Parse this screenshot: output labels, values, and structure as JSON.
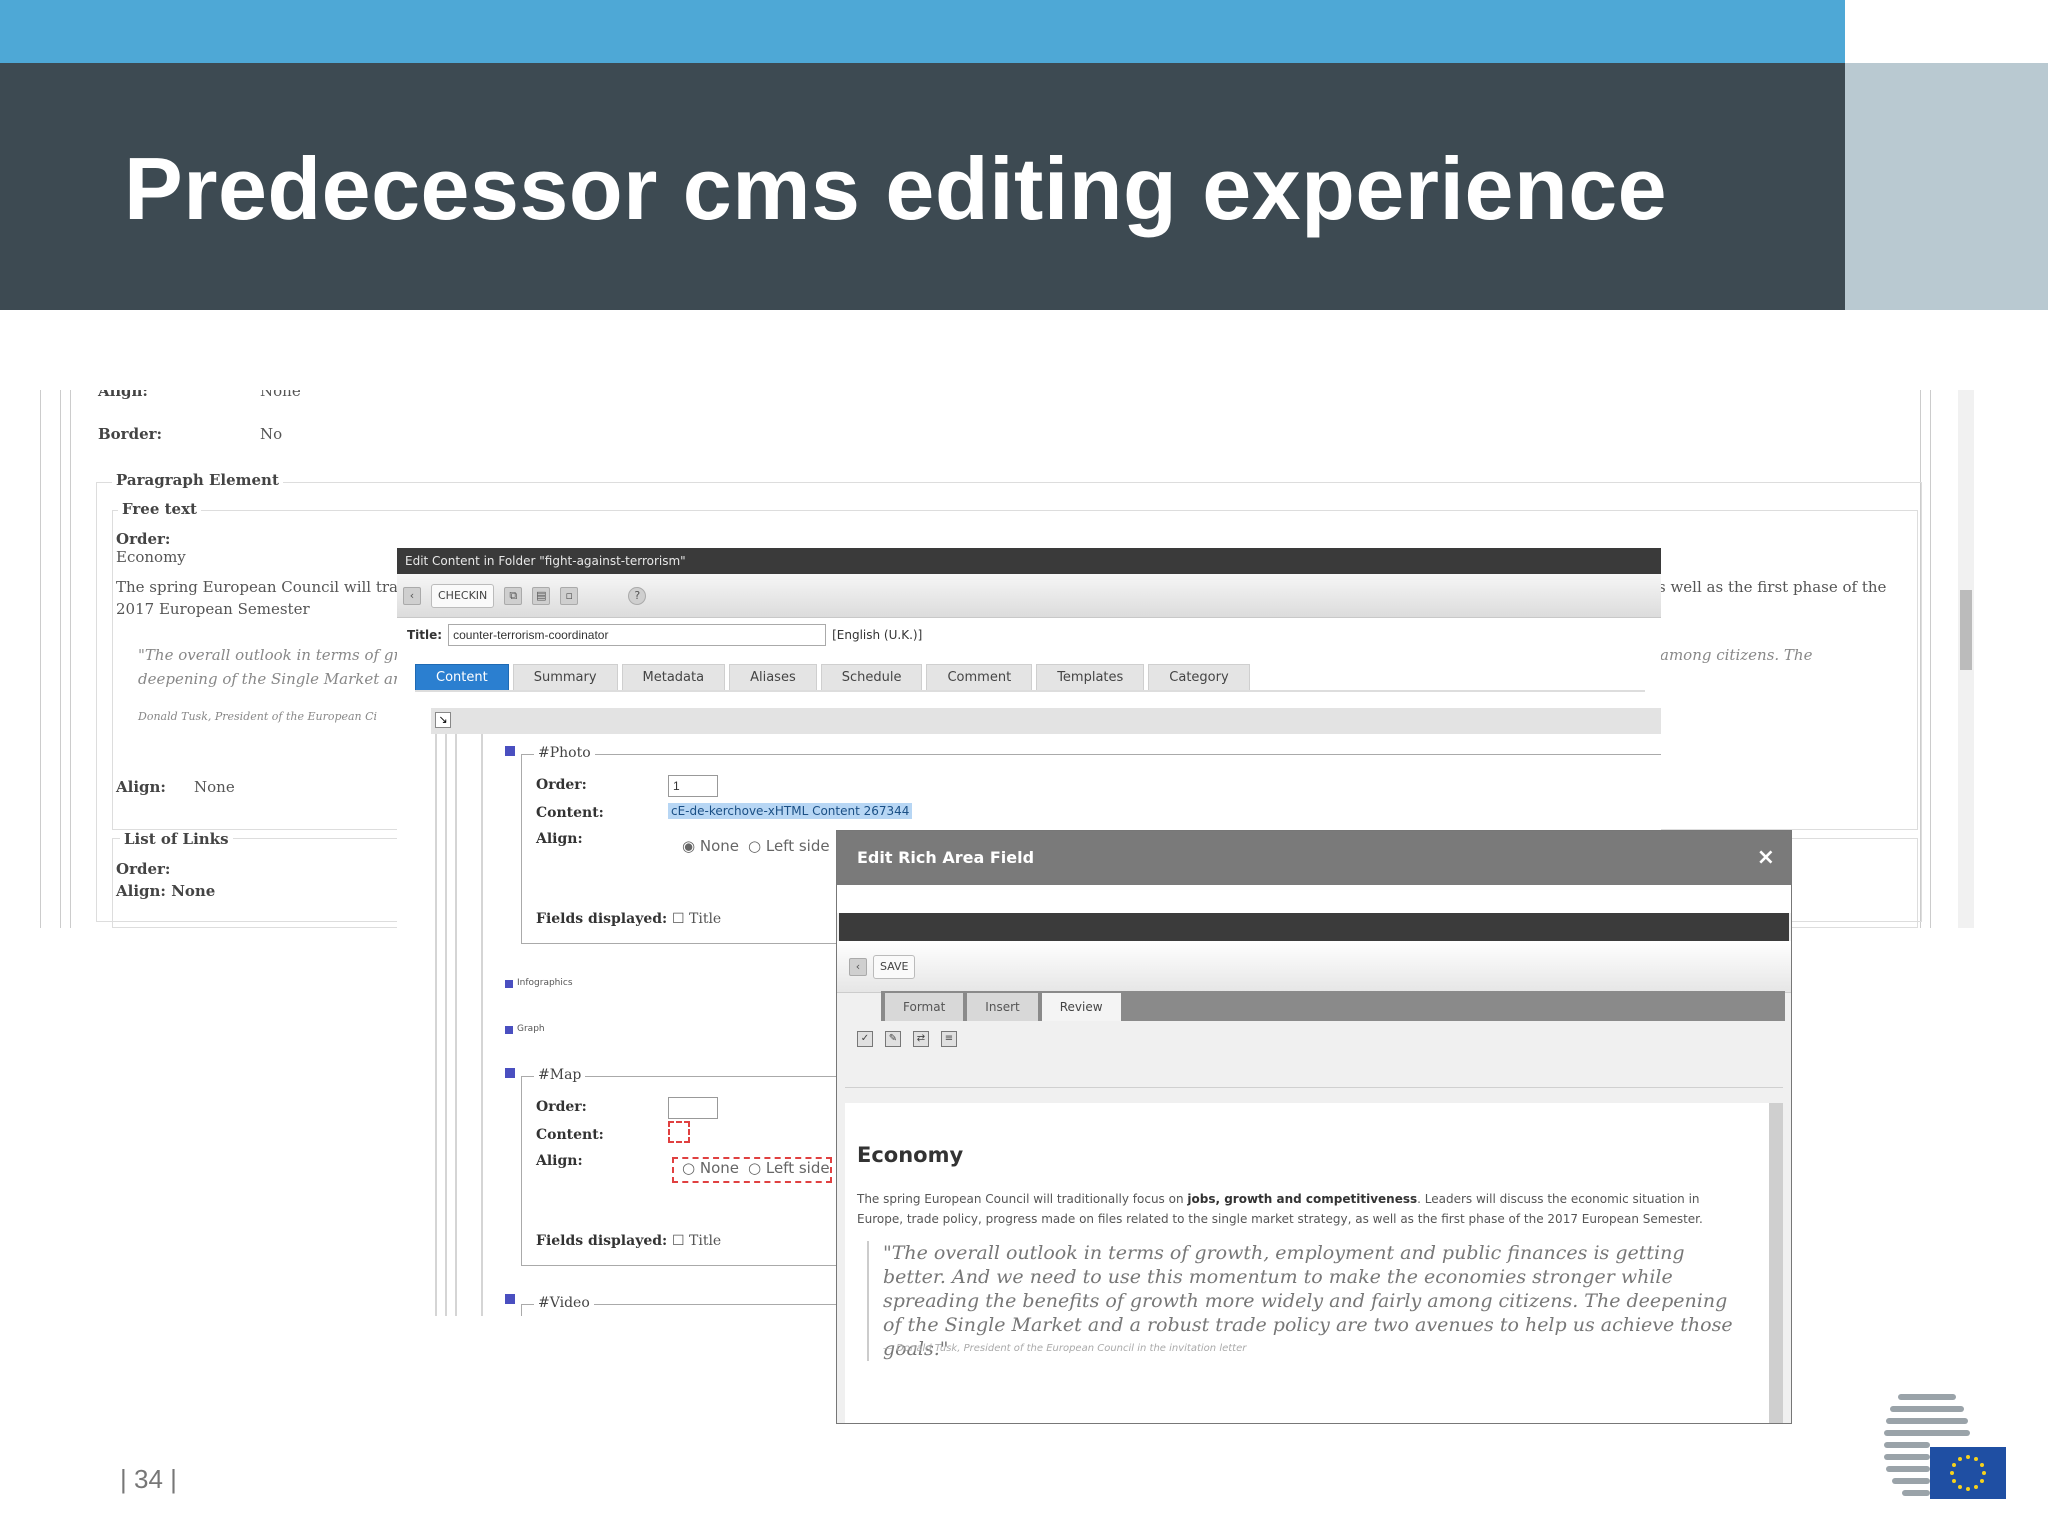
{
  "slide": {
    "title": "Predecessor cms editing experience",
    "page_number": "| 34 |"
  },
  "background_panel": {
    "align_top_label": "Align:",
    "align_top_value": "None",
    "border_label": "Border:",
    "border_value": "No",
    "paragraph_element": "Paragraph Element",
    "free_text": "Free text",
    "order_label": "Order:",
    "order_value": "Economy",
    "body_line1": "The spring European Council will traditic",
    "body_line2": "2017 European Semester",
    "body_right": "s well as the first phase of the",
    "quote_line1": "\"The overall outlook in terms of grow",
    "quote_line2": "deepening of the Single Market and",
    "quote_right": "among citizens. The",
    "attribution": "Donald Tusk, President of the European Ci",
    "align_label": "Align:",
    "align_value": "None",
    "list_of_links": "List of Links",
    "list_order_label": "Order:",
    "list_align": "Align:  None"
  },
  "edit_window": {
    "title_bar": "Edit Content in Folder \"fight-against-terrorism\"",
    "checkin_button": "CHECKIN",
    "title_label": "Title:",
    "title_value": "counter-terrorism-coordinator",
    "language": "[English (U.K.)]",
    "tabs": [
      "Content",
      "Summary",
      "Metadata",
      "Aliases",
      "Schedule",
      "Comment",
      "Templates",
      "Category"
    ],
    "photo": {
      "legend": "#Photo",
      "order_label": "Order:",
      "order_value": "1",
      "content_label": "Content:",
      "content_value": "cE-de-kerchove-xHTML Content 267344",
      "align_label": "Align:",
      "align_none": "None",
      "align_left": "Left side",
      "fields_label": "Fields displayed:",
      "fields_title": "Title"
    },
    "infographics_label": "Infographics",
    "graph_label": "Graph",
    "map": {
      "legend": "#Map",
      "order_label": "Order:",
      "content_label": "Content:",
      "align_label": "Align:",
      "align_none": "None",
      "align_left": "Left side",
      "fields_label": "Fields displayed:",
      "fields_title": "Title"
    },
    "video_legend": "#Video"
  },
  "rich_dialog": {
    "title": "Edit Rich Area Field",
    "close": "×",
    "save_button": "SAVE",
    "tabs": [
      "Format",
      "Insert",
      "Review"
    ],
    "heading": "Economy",
    "para_start": "The spring European Council will traditionally focus on ",
    "para_bold": "jobs, growth and competitiveness",
    "para_end": ". Leaders will discuss the economic situation in Europe, trade policy, progress made on files related to the single market strategy, as well as the first phase of the 2017 European Semester.",
    "quote": "\"The overall outlook in terms of growth, employment and public finances is getting better. And we need to use this momentum to make the economies stronger while spreading the benefits of growth more widely and fairly among citizens. The deepening of the Single Market and a robust trade policy are two avenues to help us achieve those goals.\"",
    "attribution": "— Donald Tusk, President of the European Council in the invitation letter"
  },
  "colors": {
    "top_strip": "#4ea8d6",
    "title_band": "#3d4a52",
    "right_block": "#b9c9d1",
    "active_tab": "#2b7fd0",
    "eu_flag": "#1f4fa3"
  }
}
